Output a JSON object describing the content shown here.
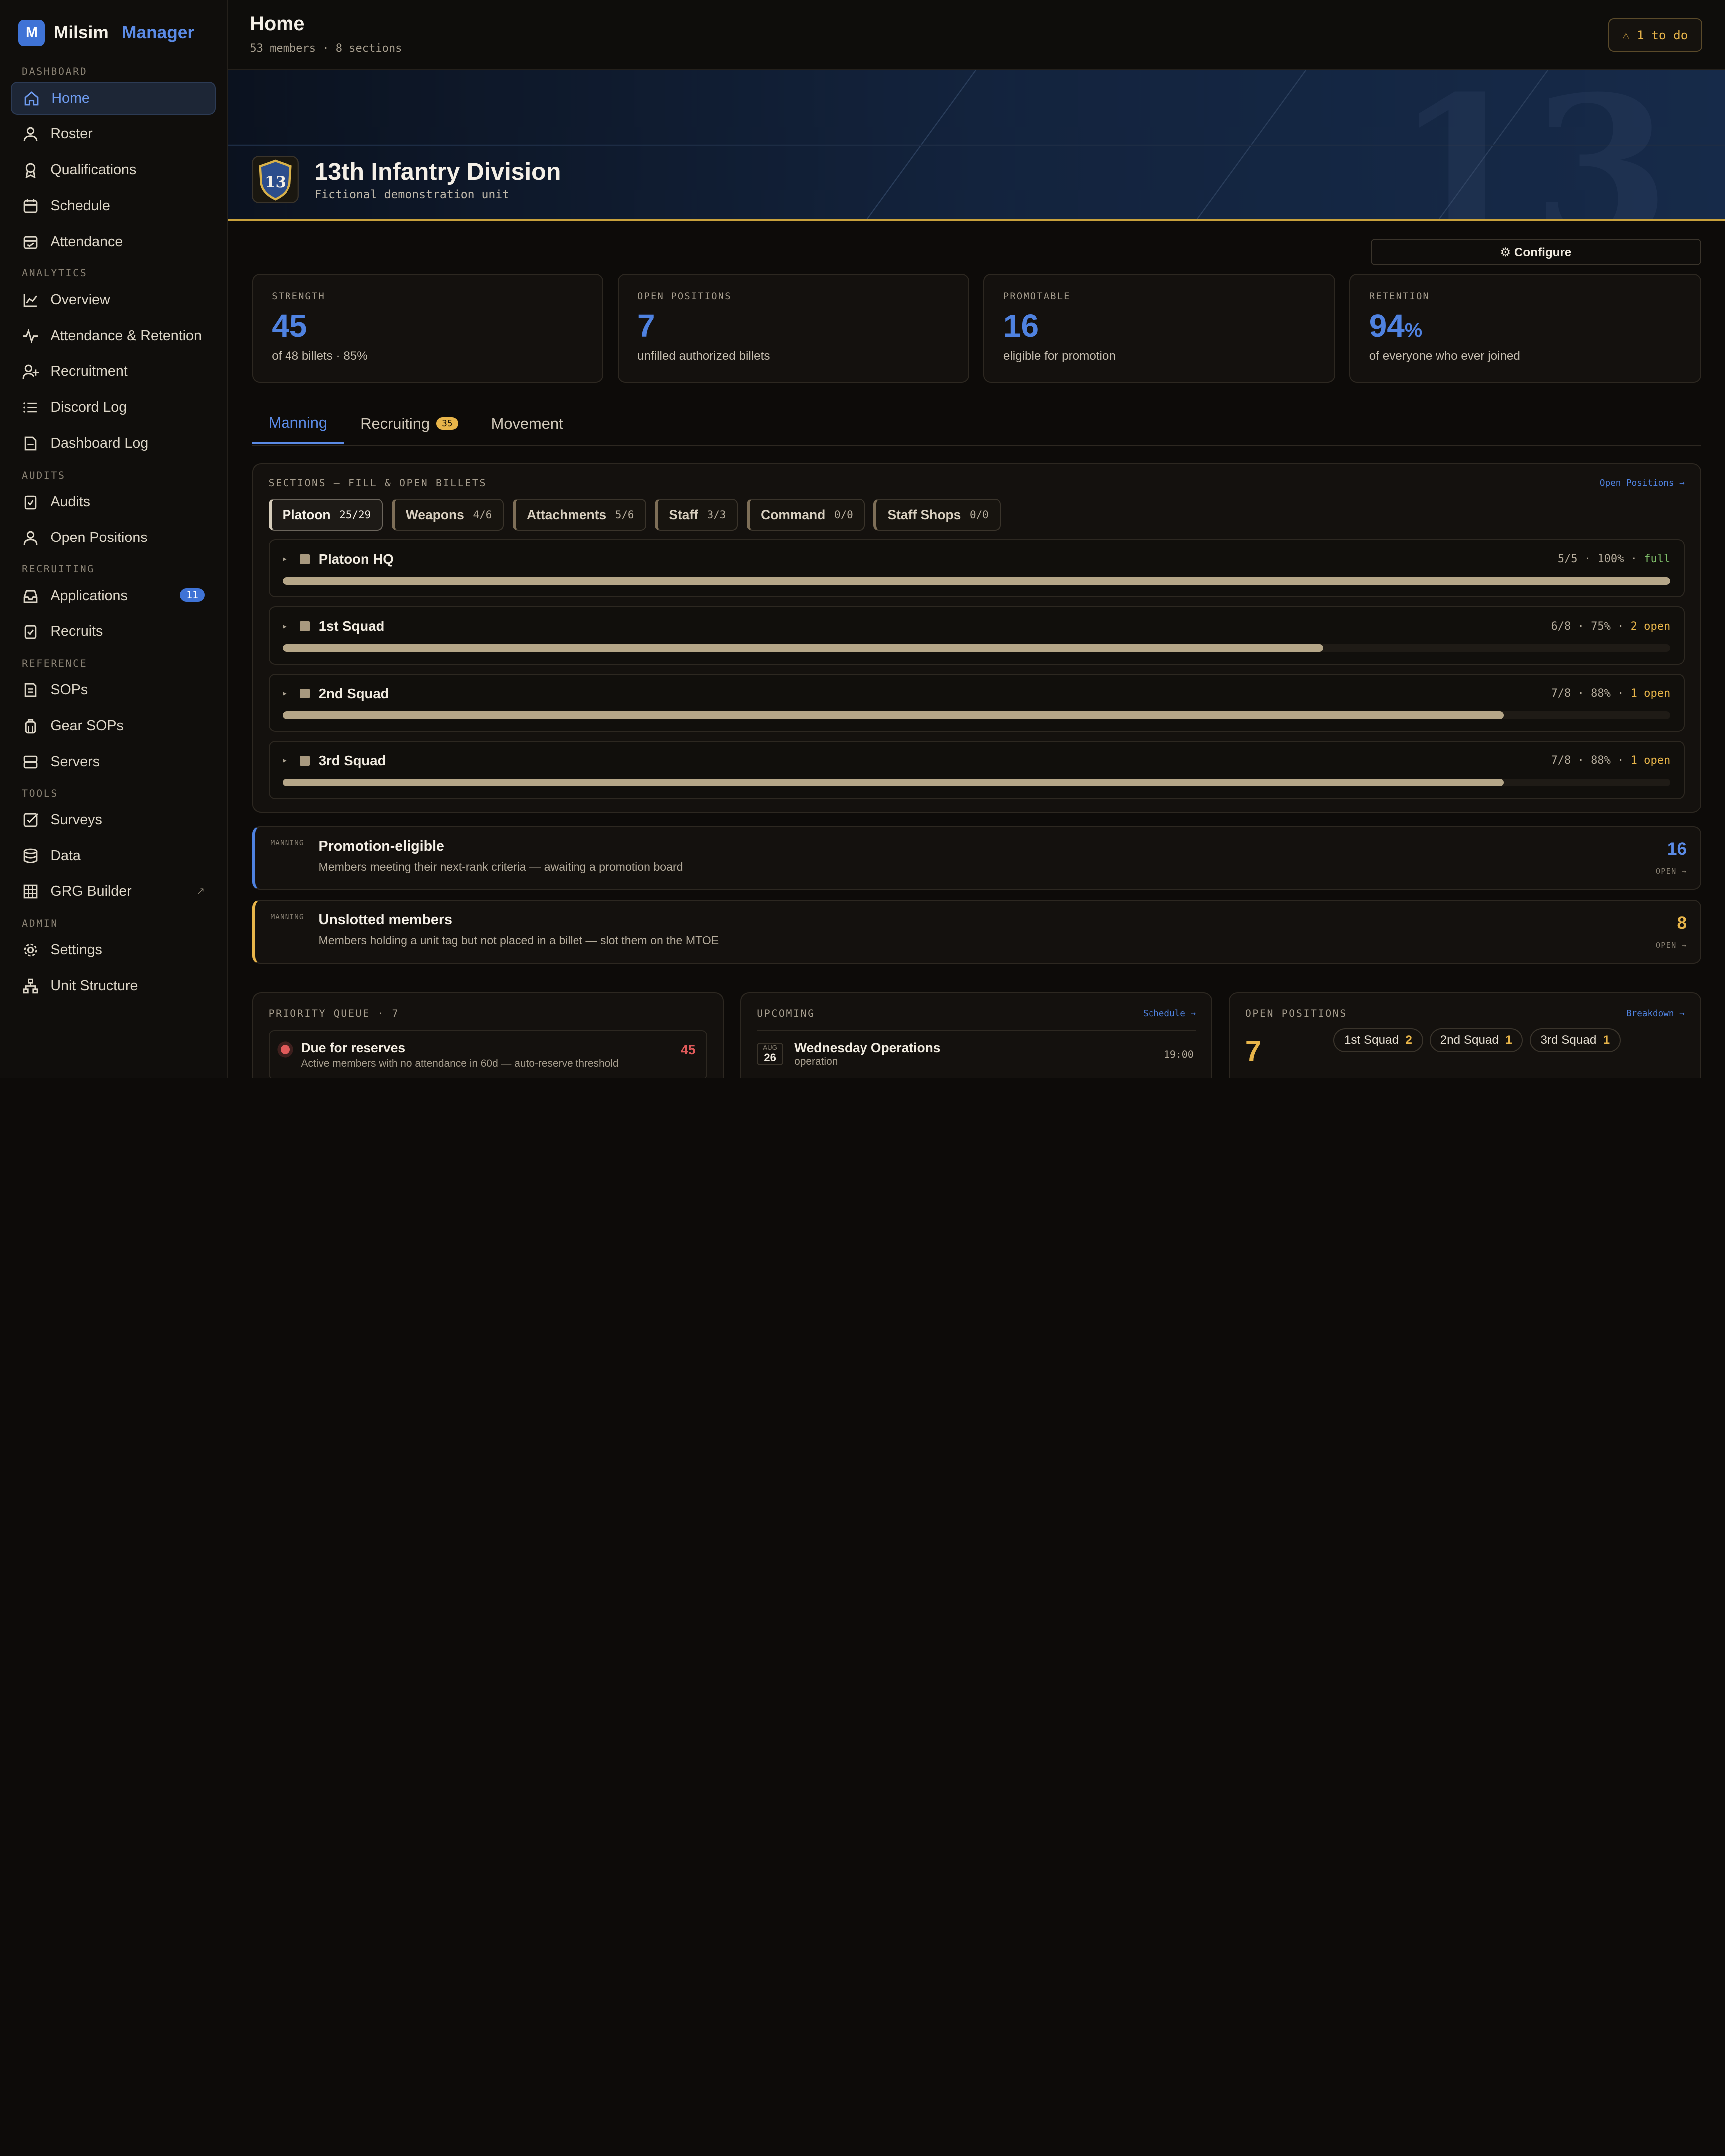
{
  "brand": {
    "name": "Milsim",
    "accent": "Manager",
    "logo_letter": "M"
  },
  "sidebar": {
    "sections": [
      {
        "label": "DASHBOARD",
        "items": [
          {
            "label": "Home",
            "icon": "home-icon",
            "active": true
          },
          {
            "label": "Roster",
            "icon": "user-icon"
          },
          {
            "label": "Qualifications",
            "icon": "award-icon"
          },
          {
            "label": "Schedule",
            "icon": "calendar-icon"
          },
          {
            "label": "Attendance",
            "icon": "calendar-check-icon"
          }
        ]
      },
      {
        "label": "ANALYTICS",
        "items": [
          {
            "label": "Overview",
            "icon": "chart-line-icon"
          },
          {
            "label": "Attendance & Retention",
            "icon": "activity-icon"
          },
          {
            "label": "Recruitment",
            "icon": "user-plus-icon"
          },
          {
            "label": "Discord Log",
            "icon": "list-icon"
          },
          {
            "label": "Dashboard Log",
            "icon": "file-icon"
          }
        ]
      },
      {
        "label": "AUDITS",
        "items": [
          {
            "label": "Audits",
            "icon": "clipboard-check-icon"
          },
          {
            "label": "Open Positions",
            "icon": "user-icon"
          }
        ]
      },
      {
        "label": "RECRUITING",
        "items": [
          {
            "label": "Applications",
            "icon": "inbox-icon",
            "badge": "11"
          },
          {
            "label": "Recruits",
            "icon": "clipboard-check-icon"
          }
        ]
      },
      {
        "label": "REFERENCE",
        "items": [
          {
            "label": "SOPs",
            "icon": "book-icon"
          },
          {
            "label": "Gear SOPs",
            "icon": "backpack-icon"
          },
          {
            "label": "Servers",
            "icon": "server-icon"
          }
        ]
      },
      {
        "label": "TOOLS",
        "items": [
          {
            "label": "Surveys",
            "icon": "checkbox-icon"
          },
          {
            "label": "Data",
            "icon": "database-icon"
          },
          {
            "label": "GRG Builder",
            "icon": "grid-icon",
            "external": "↗"
          }
        ]
      },
      {
        "label": "ADMIN",
        "items": [
          {
            "label": "Settings",
            "icon": "gear-icon"
          },
          {
            "label": "Unit Structure",
            "icon": "hierarchy-icon"
          }
        ]
      }
    ]
  },
  "header": {
    "title": "Home",
    "subtitle": "53 members · 8 sections",
    "todo_label": "⚠ 1 to do"
  },
  "hero": {
    "unit_name": "13th Infantry Division",
    "unit_desc": "Fictional demonstration unit",
    "crest_number": "13",
    "watermark": "13"
  },
  "configure_label": "⚙ Configure",
  "stats": [
    {
      "label": "STRENGTH",
      "value": "45",
      "unit": "",
      "sub": "of 48 billets · 85%"
    },
    {
      "label": "OPEN POSITIONS",
      "value": "7",
      "unit": "",
      "sub": "unfilled authorized billets"
    },
    {
      "label": "PROMOTABLE",
      "value": "16",
      "unit": "",
      "sub": "eligible for promotion"
    },
    {
      "label": "RETENTION",
      "value": "94",
      "unit": "%",
      "sub": "of everyone who ever joined"
    }
  ],
  "tabs": [
    {
      "label": "Manning",
      "active": true
    },
    {
      "label": "Recruiting",
      "badge": "35"
    },
    {
      "label": "Movement"
    }
  ],
  "sections_panel": {
    "title": "SECTIONS — FILL & OPEN BILLETS",
    "link": "Open Positions →",
    "chips": [
      {
        "label": "Platoon",
        "count": "25/29",
        "active": true
      },
      {
        "label": "Weapons",
        "count": "4/6"
      },
      {
        "label": "Attachments",
        "count": "5/6"
      },
      {
        "label": "Staff",
        "count": "3/3"
      },
      {
        "label": "Command",
        "count": "0/0"
      },
      {
        "label": "Staff Shops",
        "count": "0/0"
      }
    ],
    "rows": [
      {
        "name": "Platoon HQ",
        "stat": "5/5 · 100% · ",
        "status": "full",
        "status_kind": "full",
        "fill": 1.0
      },
      {
        "name": "1st Squad",
        "stat": "6/8 · 75% · ",
        "status": "2 open",
        "status_kind": "open",
        "fill": 0.75
      },
      {
        "name": "2nd Squad",
        "stat": "7/8 · 88% · ",
        "status": "1 open",
        "status_kind": "open",
        "fill": 0.88
      },
      {
        "name": "3rd Squad",
        "stat": "7/8 · 88% · ",
        "status": "1 open",
        "status_kind": "open",
        "fill": 0.88
      }
    ]
  },
  "alerts": [
    {
      "tag": "MANNING",
      "title": "Promotion-eligible",
      "desc": "Members meeting their next-rank criteria — awaiting a promotion board",
      "count": "16",
      "open": "OPEN →",
      "color": "blue"
    },
    {
      "tag": "MANNING",
      "title": "Unslotted members",
      "desc": "Members holding a unit tag but not placed in a billet — slot them on the MTOE",
      "count": "8",
      "open": "OPEN →",
      "color": "gold"
    }
  ],
  "priority_queue": {
    "title": "PRIORITY QUEUE · 7",
    "item": {
      "title": "Due for reserves",
      "desc": "Active members with no attendance in 60d — auto-reserve threshold",
      "count": "45"
    }
  },
  "upcoming": {
    "title": "UPCOMING",
    "link": "Schedule →",
    "item": {
      "month": "AUG",
      "day": "26",
      "title": "Wednesday Operations",
      "type": "operation",
      "time": "19:00"
    }
  },
  "open_positions": {
    "title": "OPEN POSITIONS",
    "link": "Breakdown →",
    "total": "7",
    "chips": [
      {
        "label": "1st Squad",
        "count": "2"
      },
      {
        "label": "2nd Squad",
        "count": "1"
      },
      {
        "label": "3rd Squad",
        "count": "1"
      }
    ]
  },
  "colors": {
    "accent_blue": "#4f82e0",
    "accent_gold": "#e8b54a",
    "status_red": "#e05a5a",
    "status_green": "#7fbf6a"
  }
}
